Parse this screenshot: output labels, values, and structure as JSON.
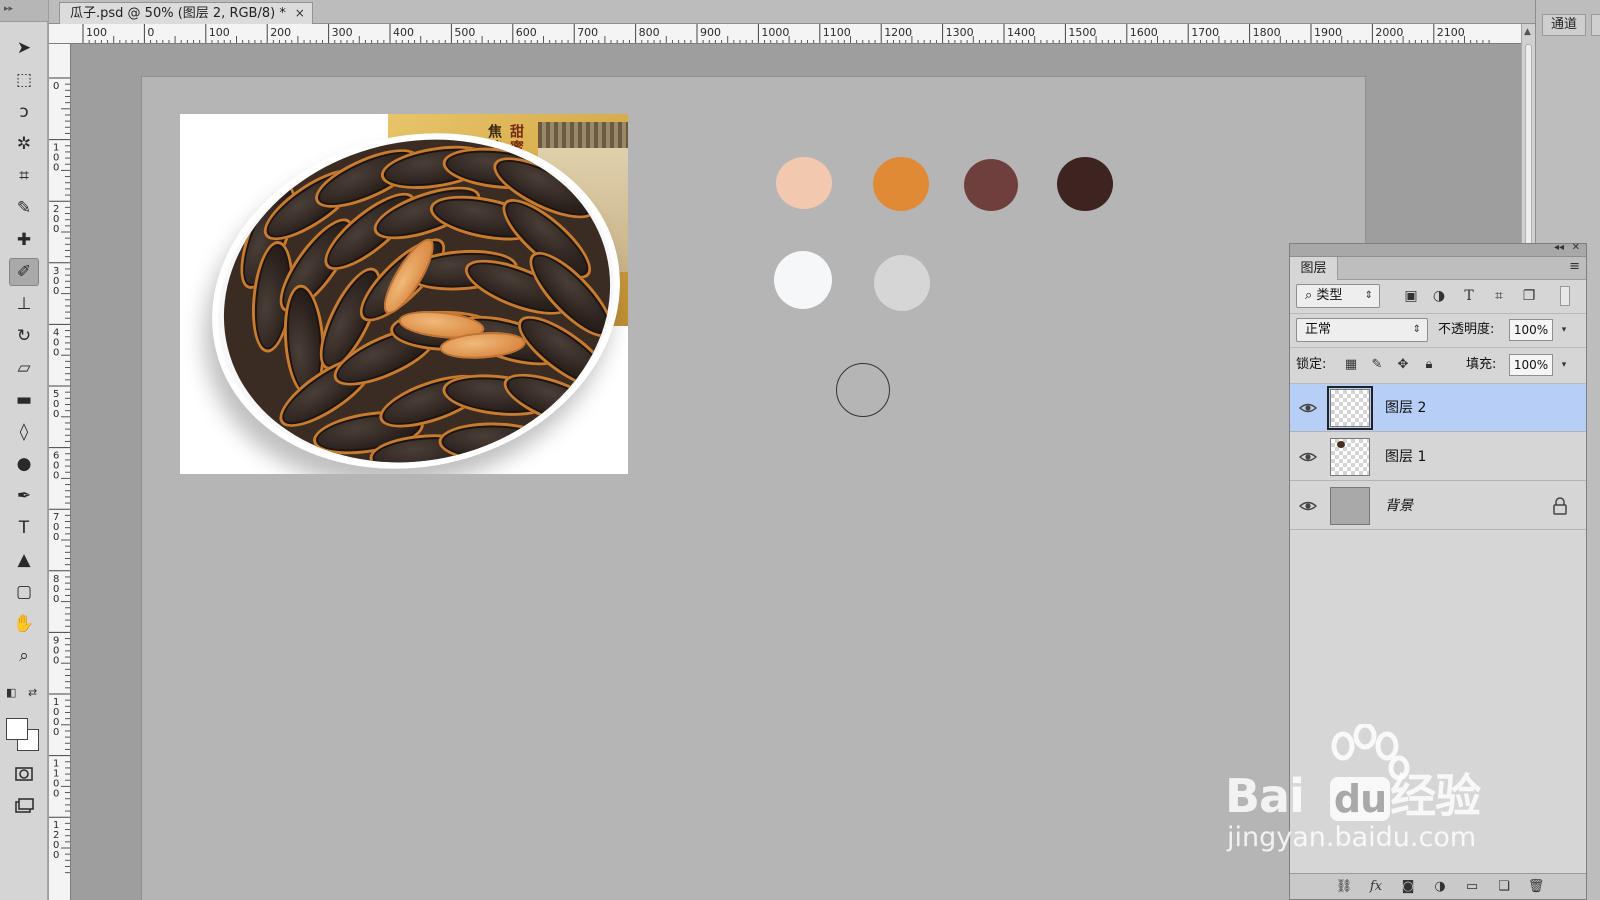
{
  "document": {
    "tab_title": "瓜子.psd @ 50% (图层 2, RGB/8) *",
    "close_glyph": "×"
  },
  "rulers": {
    "horizontal": [
      "100",
      "0",
      "100",
      "200",
      "300",
      "400",
      "500",
      "600",
      "700",
      "800",
      "900",
      "1000",
      "1100",
      "1200",
      "1300",
      "1400",
      "1500",
      "1600",
      "1700",
      "1800",
      "1900",
      "2000",
      "2100"
    ],
    "vertical": [
      "0",
      "100",
      "200",
      "300",
      "400",
      "500",
      "600",
      "700",
      "800",
      "900",
      "1000",
      "1100",
      "1200"
    ]
  },
  "toolbar": {
    "tools": [
      {
        "name": "move-tool",
        "icon": "move-arrow-icon",
        "glyph": "➤"
      },
      {
        "name": "marquee-tool",
        "icon": "rect-marquee-icon",
        "glyph": "⬚"
      },
      {
        "name": "lasso-tool",
        "icon": "lasso-icon",
        "glyph": "ↄ"
      },
      {
        "name": "quick-select-tool",
        "icon": "magic-wand-icon",
        "glyph": "✲"
      },
      {
        "name": "crop-tool",
        "icon": "crop-icon",
        "glyph": "⌗"
      },
      {
        "name": "eyedropper-tool",
        "icon": "eyedropper-icon",
        "glyph": "✎"
      },
      {
        "name": "healing-brush-tool",
        "icon": "bandage-icon",
        "glyph": "✚"
      },
      {
        "name": "brush-tool",
        "icon": "brush-icon",
        "glyph": "✐",
        "active": true
      },
      {
        "name": "clone-stamp-tool",
        "icon": "stamp-icon",
        "glyph": "⊥"
      },
      {
        "name": "history-brush-tool",
        "icon": "history-brush-icon",
        "glyph": "↻"
      },
      {
        "name": "eraser-tool",
        "icon": "eraser-icon",
        "glyph": "▱"
      },
      {
        "name": "gradient-tool",
        "icon": "gradient-icon",
        "glyph": "▬"
      },
      {
        "name": "blur-tool",
        "icon": "drop-icon",
        "glyph": "◊"
      },
      {
        "name": "dodge-tool",
        "icon": "dodge-icon",
        "glyph": "●"
      },
      {
        "name": "pen-tool",
        "icon": "pen-icon",
        "glyph": "✒"
      },
      {
        "name": "type-tool",
        "icon": "type-icon",
        "glyph": "T"
      },
      {
        "name": "path-select-tool",
        "icon": "path-select-icon",
        "glyph": "▲"
      },
      {
        "name": "shape-tool",
        "icon": "rounded-rect-icon",
        "glyph": "▢"
      },
      {
        "name": "hand-tool",
        "icon": "hand-icon",
        "glyph": "✋"
      },
      {
        "name": "zoom-tool",
        "icon": "zoom-icon",
        "glyph": "⌕"
      }
    ],
    "foreground_color": "#ffffff",
    "background_color": "#ffffff"
  },
  "canvas": {
    "photo_label_1": "焦糖",
    "photo_label_2": "甜蜜",
    "swatches": [
      {
        "name": "peach",
        "color": "#f2c9af"
      },
      {
        "name": "orange",
        "color": "#e08a35"
      },
      {
        "name": "mauve-brown",
        "color": "#6f3f3d"
      },
      {
        "name": "dark-brown",
        "color": "#3d2420"
      },
      {
        "name": "white",
        "color": "#f5f7f8"
      },
      {
        "name": "light-gray",
        "color": "#d6d6d6"
      }
    ]
  },
  "right_dock": {
    "channels_tab": "通道"
  },
  "layers_panel": {
    "tab": "图层",
    "filter_kind": "类型",
    "blend_mode": "正常",
    "opacity_label": "不透明度:",
    "opacity_value": "100%",
    "lock_label": "锁定:",
    "fill_label": "填充:",
    "fill_value": "100%",
    "layers": [
      {
        "name": "图层 2",
        "selected": true,
        "visible": true
      },
      {
        "name": "图层 1",
        "selected": false,
        "visible": true
      },
      {
        "name": "背景",
        "selected": false,
        "visible": true,
        "locked": true
      }
    ]
  },
  "watermark": {
    "logo_left": "Bai",
    "logo_right": "经验",
    "logo_du": "du",
    "url": "jingyan.baidu.com"
  }
}
